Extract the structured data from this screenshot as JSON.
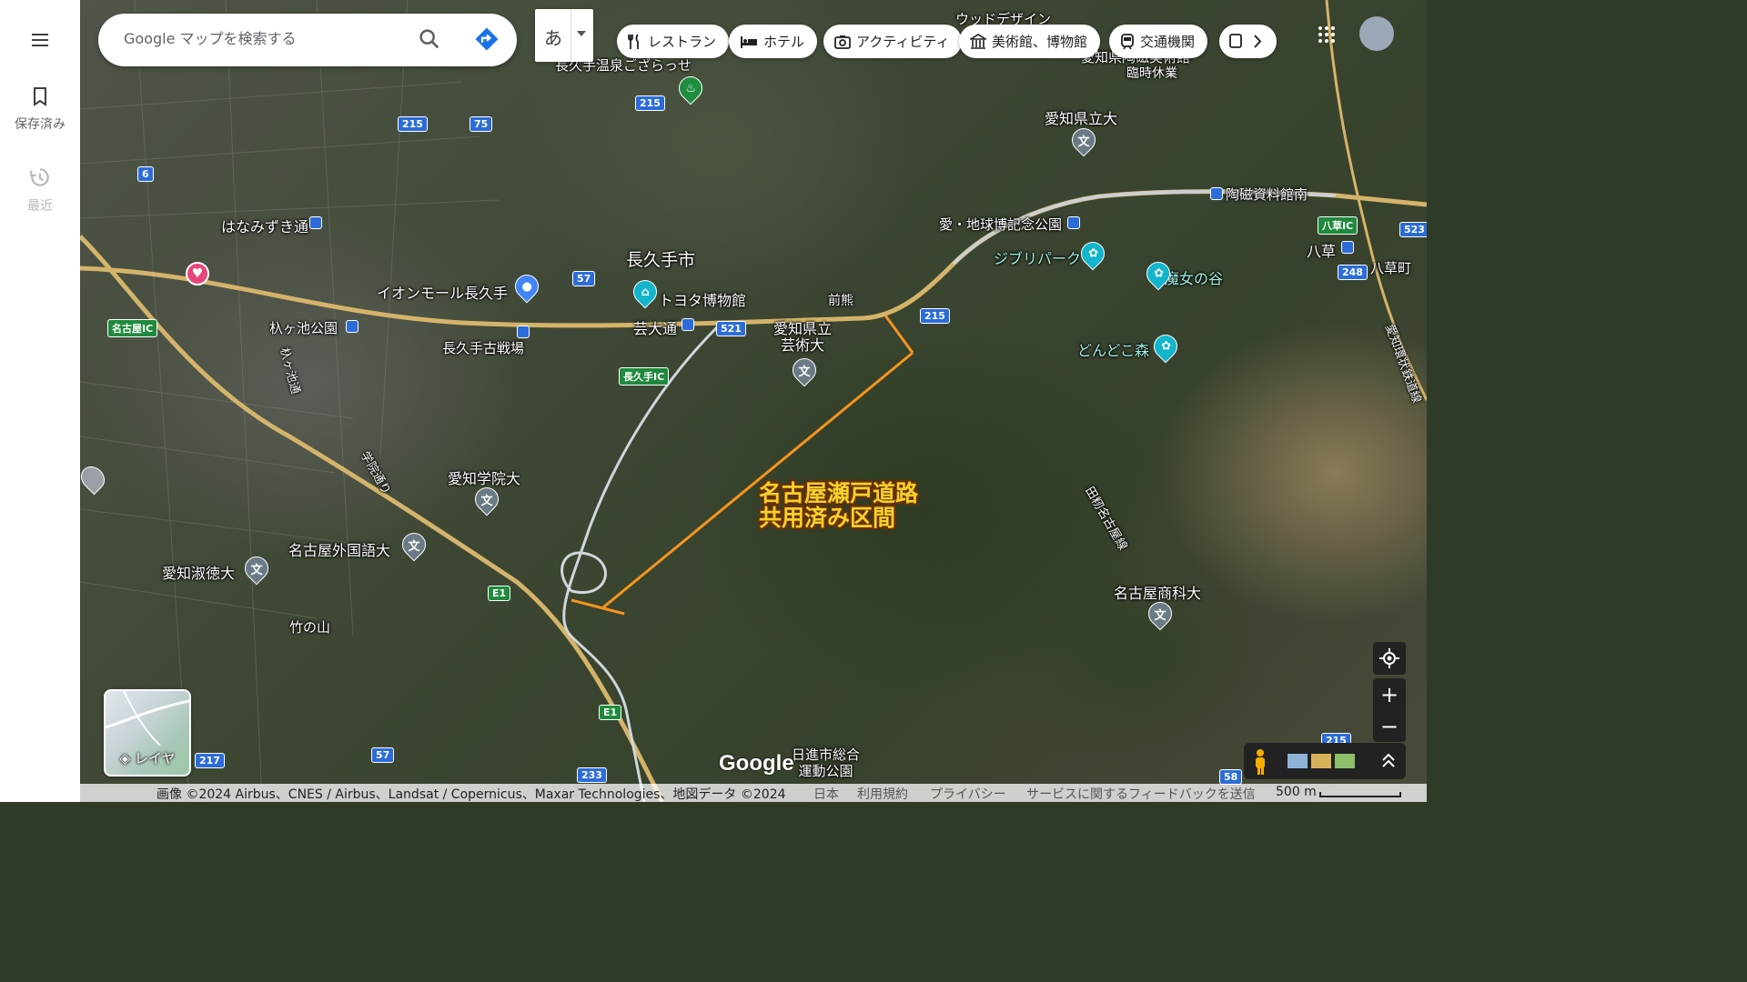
{
  "rail": {
    "saved_label": "保存済み",
    "recent_label": "最近"
  },
  "search": {
    "placeholder": "Google マップを検索する"
  },
  "ime": {
    "char": "あ"
  },
  "chips": [
    {
      "label": "レストラン",
      "icon": "fork-knife-icon"
    },
    {
      "label": "ホテル",
      "icon": "bed-icon"
    },
    {
      "label": "アクティビティ",
      "icon": "camera-icon"
    },
    {
      "label": "美術館、博物館",
      "icon": "museum-icon"
    },
    {
      "label": "交通機関",
      "icon": "train-icon"
    }
  ],
  "map": {
    "places": {
      "nagakute_city": "長久手市",
      "toyota_museum": "トヨタ博物館",
      "aeon": "イオンモール長久手",
      "geidaidori": "芸大通",
      "aichi_geidai": "愛知県立\n芸術大",
      "maekuma": "前熊",
      "expo_park": "愛・地球博記念公園",
      "ghibli_park": "ジブリパーク",
      "majo": "魔女の谷",
      "dondoko": "どんどこ森",
      "touji": "陶磁資料館南",
      "yakusa": "八草",
      "yakusa_town": "八草町",
      "aichi_pref_univ": "愛知県立大",
      "hanamizuki": "はなみずき通",
      "hagaike": "杁ヶ池公園",
      "nagakute_kosenjo": "長久手古戦場",
      "nagoya_ic": "名古屋IC",
      "nagakute_ic": "長久手IC",
      "yakusa_ic": "八草IC",
      "aichi_gakuin": "愛知学院大",
      "nagoya_gaikokugo": "名古屋外国語大",
      "aichi_shukutoku": "愛知淑徳大",
      "takenoyama": "竹の山",
      "nagoya_shoka": "名古屋商科大",
      "nisshin_park": "日進市総合\n運動公園",
      "onsen": "長久手温泉ござらっせ",
      "wood_design": "ウッドデザイン",
      "aichi_kogei": "愛知県陶磁美術館",
      "rinji": "臨時休業",
      "gakuin_dori": "学院通り",
      "tahira_line": "田籾名古屋線",
      "aichi_kanjo": "愛知環状鉄道線",
      "hagaike_dori": "杁ヶ池通"
    },
    "shields": [
      "215",
      "75",
      "215",
      "6",
      "57",
      "521",
      "215",
      "248",
      "523",
      "217",
      "57",
      "233",
      "E1",
      "E1",
      "58",
      "215"
    ],
    "annotation": "名古屋瀬戸道路\n共用済み区間",
    "annotation_color": "#f5d12a",
    "line_color": "#f7941d"
  },
  "layers_label": "レイヤ",
  "google_logo": "Google",
  "footer": {
    "attribution": "画像 ©2024 Airbus、CNES / Airbus、Landsat / Copernicus、Maxar Technologies、地図データ ©2024",
    "japan": "日本",
    "terms": "利用規約",
    "privacy": "プライバシー",
    "feedback": "サービスに関するフィードバックを送信",
    "scale": "500 m"
  }
}
